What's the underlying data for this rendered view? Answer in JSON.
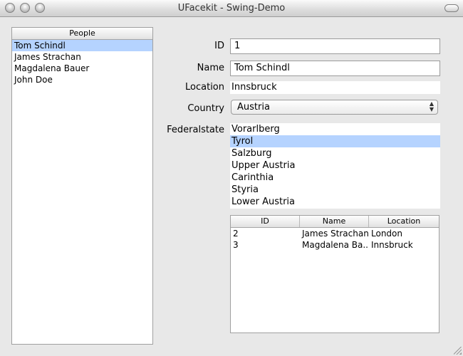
{
  "window": {
    "title": "UFacekit - Swing-Demo"
  },
  "people": {
    "header": "People",
    "items": [
      "Tom Schindl",
      "James Strachan",
      "Magdalena Bauer",
      "John Doe"
    ],
    "selected_index": 0
  },
  "form": {
    "id_label": "ID",
    "id_value": "1",
    "name_label": "Name",
    "name_value": "Tom Schindl",
    "location_label": "Location",
    "location_value": "Innsbruck",
    "country_label": "Country",
    "country_value": "Austria",
    "federalstate_label": "Federalstate",
    "federalstates": [
      "Vorarlberg",
      "Tyrol",
      "Salzburg",
      "Upper Austria",
      "Carinthia",
      "Styria",
      "Lower Austria"
    ],
    "federalstate_selected_index": 1
  },
  "friends_table": {
    "columns": [
      "ID",
      "Name",
      "Location"
    ],
    "rows": [
      [
        "2",
        "James Strachan",
        "London"
      ],
      [
        "3",
        "Magdalena Ba...",
        "Innsbruck"
      ]
    ]
  },
  "colors": {
    "selection": "#b5d3ff"
  },
  "icons": {
    "country_dropdown": "updown-arrows-icon",
    "resize": "resize-grip-icon"
  }
}
